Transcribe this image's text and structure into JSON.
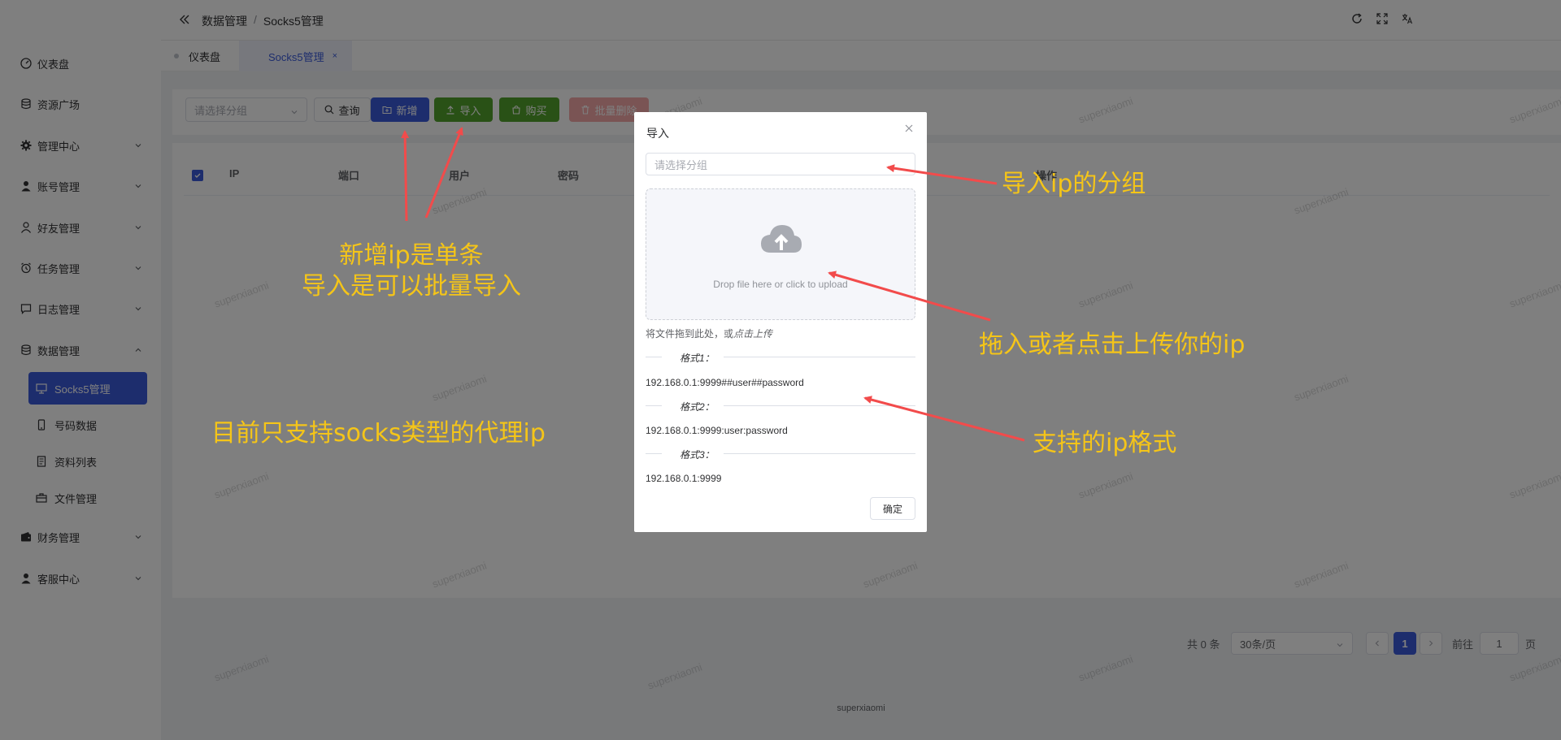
{
  "header": {
    "breadcrumb": [
      "数据管理",
      "Socks5管理"
    ],
    "separator": "/"
  },
  "sidebar": {
    "items": [
      {
        "label": "仪表盘",
        "icon": "dashboard-icon"
      },
      {
        "label": "资源广场",
        "icon": "database-icon"
      },
      {
        "label": "管理中心",
        "icon": "gear-icon"
      },
      {
        "label": "账号管理",
        "icon": "user-icon"
      },
      {
        "label": "好友管理",
        "icon": "user-outline-icon"
      },
      {
        "label": "任务管理",
        "icon": "alarm-icon"
      },
      {
        "label": "日志管理",
        "icon": "chat-icon"
      },
      {
        "label": "数据管理",
        "icon": "database-icon"
      }
    ],
    "submenu": [
      {
        "label": "Socks5管理",
        "icon": "monitor-icon"
      },
      {
        "label": "号码数据",
        "icon": "phone-icon"
      },
      {
        "label": "资料列表",
        "icon": "document-icon"
      },
      {
        "label": "文件管理",
        "icon": "suitcase-icon"
      }
    ],
    "bottom_items": [
      {
        "label": "财务管理",
        "icon": "wallet-icon"
      },
      {
        "label": "客服中心",
        "icon": "user-icon"
      }
    ]
  },
  "tabs": [
    {
      "label": "仪表盘"
    },
    {
      "label": "Socks5管理",
      "close": "×"
    }
  ],
  "toolbar": {
    "group_placeholder": "请选择分组",
    "query_label": "查询",
    "add_label": "新增",
    "import_label": "导入",
    "buy_label": "购买",
    "batch_delete_label": "批量删除"
  },
  "table": {
    "columns": [
      "IP",
      "端口",
      "用户",
      "密码",
      "操作"
    ]
  },
  "pagination": {
    "total": "共 0 条",
    "page_size": "30条/页",
    "current_page": "1",
    "goto_label": "前往",
    "goto_value": "1",
    "page_suffix": "页"
  },
  "footer": "superxiaomi",
  "watermark": "superxiaomi",
  "dialog": {
    "title": "导入",
    "group_placeholder": "请选择分组",
    "upload_text": "Drop file here or click to upload",
    "tip_prefix": "将文件拖到此处，或",
    "tip_link": "点击上传",
    "format1_label": "格式1：",
    "format1_value": "192.168.0.1:9999##user##password",
    "format2_label": "格式2：",
    "format2_value": "192.168.0.1:9999:user:password",
    "format3_label": "格式3：",
    "format3_value": "192.168.0.1:9999",
    "ok_label": "确定"
  },
  "annotations": {
    "add_line1": "新增ip是单条",
    "add_line2": "导入是可以批量导入",
    "socks_only": "目前只支持socks类型的代理ip",
    "import_group": "导入ip的分组",
    "drag_upload": "拖入或者点击上传你的ip",
    "formats": "支持的ip格式"
  },
  "colors": {
    "primary": "#3b5bdb",
    "success": "#52a22c",
    "annotation": "#f5c518",
    "arrow": "#f24b4b"
  }
}
